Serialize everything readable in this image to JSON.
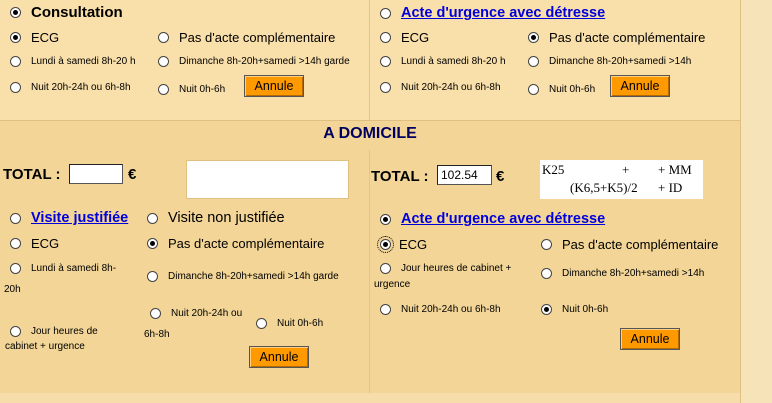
{
  "top_left": {
    "consultation": "Consultation",
    "ecg": "ECG",
    "pas_acte": "Pas d'acte complémentaire",
    "lundi": "Lundi à samedi 8h-20 h",
    "dimanche": "Dimanche 8h-20h+samedi >14h garde",
    "nuit_20": "Nuit 20h-24h ou 6h-8h",
    "nuit_0": "Nuit 0h-6h",
    "annule": "Annule"
  },
  "top_right": {
    "acte_urgence": "Acte d'urgence avec détresse",
    "ecg": "ECG",
    "pas_acte": "Pas d'acte complémentaire",
    "lundi": "Lundi à samedi 8h-20 h",
    "dimanche": "Dimanche 8h-20h+samedi >14h",
    "nuit_20": "Nuit 20h-24h ou 6h-8h",
    "nuit_0": "Nuit 0h-6h",
    "annule": "Annule"
  },
  "section_title": "A DOMICILE",
  "bottom_left": {
    "total_label": "TOTAL :",
    "total_value": "",
    "euro": "€",
    "visite_justifiee": "Visite justifiée",
    "visite_non_justifiee": "Visite non justifiée",
    "ecg": "ECG",
    "pas_acte": "Pas d'acte complémentaire",
    "lundi_a": "Lundi à samedi 8h-",
    "lundi_b": "20h",
    "dimanche": "Dimanche 8h-20h+samedi >14h garde",
    "nuit_20_a": "Nuit 20h-24h ou",
    "nuit_20_b": "6h-8h",
    "nuit_0": "Nuit 0h-6h",
    "jour_a": "Jour heures de",
    "jour_b": "cabinet + urgence",
    "annule": "Annule"
  },
  "bottom_right": {
    "total_label": "TOTAL :",
    "total_value": "102.54",
    "euro": "€",
    "formula": {
      "k25": "K25",
      "plus1": "+",
      "mm": "+ MM",
      "k6": "(K6,5+K5)/2",
      "id": "+ ID"
    },
    "acte_urgence": "Acte d'urgence avec détresse",
    "ecg": "ECG",
    "pas_acte": "Pas d'acte complémentaire",
    "jour_a": "Jour heures de cabinet +",
    "jour_b": "urgence",
    "dimanche": "Dimanche 8h-20h+samedi >14h",
    "nuit_20": "Nuit 20h-24h ou 6h-8h",
    "nuit_0": "Nuit 0h-6h",
    "annule": "Annule"
  },
  "colors": {
    "link": "#0000dd",
    "title": "#000060",
    "button": "#ff9900",
    "panel": "#f9dfa9"
  }
}
